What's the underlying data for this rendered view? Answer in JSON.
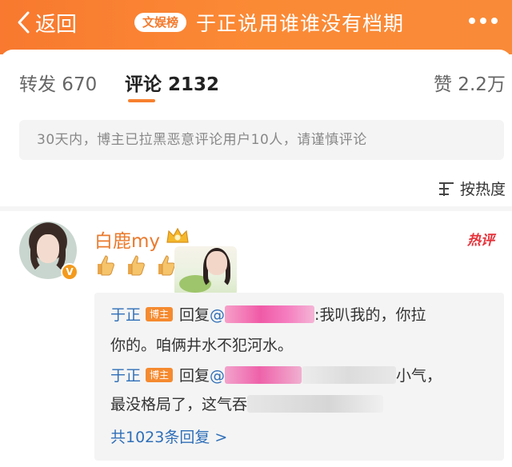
{
  "header": {
    "back_label": "返回",
    "tag": "文娱榜",
    "title": "于正说用谁谁没有档期",
    "background": "#f98538"
  },
  "tabs": [
    {
      "label": "转发 670",
      "active": false
    },
    {
      "label": "评论 2132",
      "active": true
    },
    {
      "label": "赞 2.2万",
      "active": false
    }
  ],
  "notice": "30天内，博主已拉黑恶意评论用户10人，请谨慎评论",
  "sort": {
    "label": "按热度",
    "icon": "sort-icon"
  },
  "comment": {
    "username": "白鹿my",
    "verified_badge": "V",
    "hot_label": "热评",
    "emoji": [
      "thumbs-up",
      "thumbs-up",
      "thumbs-up"
    ],
    "replies": [
      {
        "author": "于正",
        "badge": "博主",
        "reply_word": "回复",
        "mention": "@",
        "text_after_mask": ":我叭我的，你拉",
        "continued": "你的。咱俩井水不犯河水。"
      },
      {
        "author": "于正",
        "badge": "博主",
        "reply_word": "回复",
        "mention": "@",
        "text_after_mask": "小气，",
        "continued": "最没格局了，这气吞"
      }
    ],
    "more_replies": "共1023条回复 >"
  },
  "colors": {
    "accent": "#f7812f",
    "link": "#2f6fb8",
    "hot": "#e6323a"
  }
}
